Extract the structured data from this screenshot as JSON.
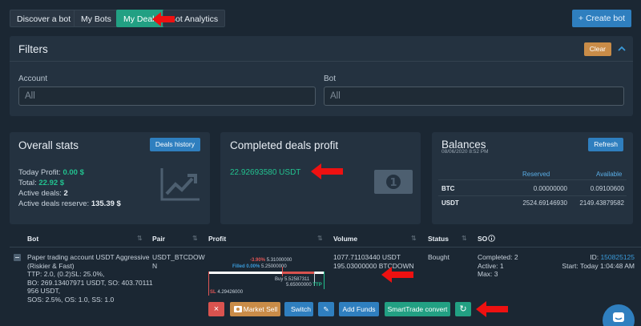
{
  "nav": {
    "tabs": [
      "Discover a bot",
      "My Bots",
      "My Deals",
      "Bot Analytics"
    ],
    "create_bot": "+ Create bot"
  },
  "filters": {
    "title": "Filters",
    "clear": "Clear",
    "account_label": "Account",
    "account_value": "All",
    "bot_label": "Bot",
    "bot_value": "All"
  },
  "overall": {
    "title": "Overall stats",
    "history_button": "Deals history",
    "today_label": "Today Profit:",
    "today_value": "0.00 $",
    "total_label": "Total:",
    "total_value": "22.92 $",
    "active_label": "Active deals:",
    "active_value": "2",
    "reserve_label": "Active deals reserve:",
    "reserve_value": "135.39 $"
  },
  "completed": {
    "title": "Completed deals profit",
    "value": "22.92693580 USDT"
  },
  "balances": {
    "title": "Balances",
    "timestamp": "08/06/2020 8:52 PM",
    "refresh": "Refresh",
    "col_reserved": "Reserved",
    "col_available": "Available",
    "rows": [
      {
        "coin": "BTC",
        "reserved": "0.00000000",
        "available": "0.09100600"
      },
      {
        "coin": "USDT",
        "reserved": "2524.69146930",
        "available": "2149.43879582"
      }
    ]
  },
  "table": {
    "headers": [
      "Bot",
      "Pair",
      "Profit",
      "Volume",
      "Status",
      "SO"
    ],
    "row": {
      "bot_name": [
        "Paper trading account USDT Aggressive",
        "(Riskier & Fast)"
      ],
      "bot_details": [
        "TTP: 2.0, (0.2)SL: 25.0%,",
        "BO: 269.13407971 USDT, SO: 403.70111",
        "956 USDT,",
        "SOS: 2.5%, OS: 1.0, SS: 1.0"
      ],
      "pair": [
        "USDT_BTCDOW",
        "N"
      ],
      "profit_pct": "-3.90%",
      "profit_price": "5.31000000",
      "filled_label": "Filled 0.00%",
      "filled_price": "5.25000000",
      "buy_label": "Buy 5.52587311",
      "tp_price": "5.65000000",
      "tp_label": "TTP",
      "sl_label": "SL",
      "sl_price": "4.29426000",
      "volume": [
        "1077.71103440 USDT",
        "195.03000000 BTCDOWN"
      ],
      "status": "Bought",
      "so": [
        "Completed: 2",
        "Active: 1",
        "Max: 3"
      ],
      "id_label": "ID:",
      "id_value": "150825125",
      "start": "Start: Today 1:04:48 AM"
    },
    "actions": [
      "×",
      "Market Sell",
      "Switch",
      "✎",
      "Add Funds",
      "SmartTrade convert",
      "↻"
    ]
  },
  "colors": {
    "accent": "#22a083",
    "blue": "#2f7fbf",
    "danger": "#d9534f",
    "arrow": "#ee1111"
  }
}
